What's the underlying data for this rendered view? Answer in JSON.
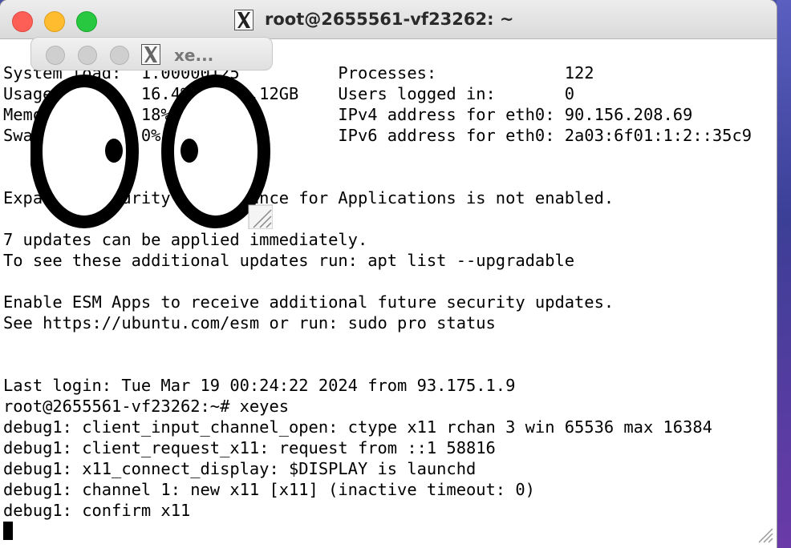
{
  "window": {
    "title": "root@2655561-vf23262: ~",
    "traffic_lights": [
      "close",
      "minimize",
      "zoom"
    ],
    "app_icon": "x11-logo-icon"
  },
  "terminal": {
    "lines": [
      "System load:  1.00000125          Processes:             122",
      "Usage of /:   16.4% of 29.12GB    Users logged in:       0",
      "Memory usage: 18%                 IPv4 address for eth0: 90.156.208.69",
      "Swap usage:   0%                  IPv6 address for eth0: 2a03:6f01:1:2::35c9",
      "",
      "",
      "Expanded Security Maintenance for Applications is not enabled.",
      "",
      "7 updates can be applied immediately.",
      "To see these additional updates run: apt list --upgradable",
      "",
      "Enable ESM Apps to receive additional future security updates.",
      "See https://ubuntu.com/esm or run: sudo pro status",
      "",
      "",
      "Last login: Tue Mar 19 00:24:22 2024 from 93.175.1.9",
      "root@2655561-vf23262:~# xeyes",
      "debug1: client_input_channel_open: ctype x11 rchan 3 win 65536 max 16384",
      "debug1: client_request_x11: request from ::1 58816",
      "debug1: x11_connect_display: $DISPLAY is launchd",
      "debug1: channel 1: new x11 [x11] (inactive timeout: 0)",
      "debug1: confirm x11"
    ]
  },
  "xeyes": {
    "title": "xe...",
    "app_icon": "x11-logo-icon",
    "traffic_lights": [
      "close",
      "minimize",
      "zoom"
    ],
    "state": "inactive"
  },
  "colors": {
    "close": "#fd5f57",
    "minimize": "#febc2e",
    "zoom": "#28c840",
    "inactive_light": "#cfcfcf",
    "terminal_bg": "#ffffff",
    "terminal_fg": "#000000"
  }
}
